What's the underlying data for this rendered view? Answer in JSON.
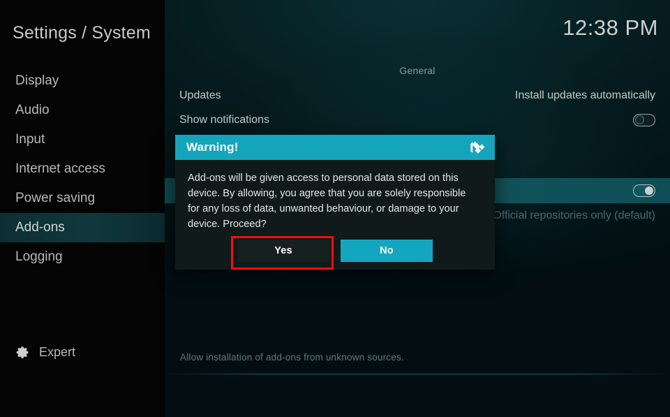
{
  "window": {
    "title": "Settings / System",
    "clock": "12:38 PM"
  },
  "sidebar": {
    "items": [
      {
        "label": "Display",
        "selected": false
      },
      {
        "label": "Audio",
        "selected": false
      },
      {
        "label": "Input",
        "selected": false
      },
      {
        "label": "Internet access",
        "selected": false
      },
      {
        "label": "Power saving",
        "selected": false
      },
      {
        "label": "Add-ons",
        "selected": true
      },
      {
        "label": "Logging",
        "selected": false
      }
    ],
    "level_button": {
      "label": "Expert",
      "icon": "gear-icon"
    }
  },
  "main": {
    "group_header": "General",
    "rows": [
      {
        "label": "Updates",
        "value": "Install updates automatically",
        "control": "text"
      },
      {
        "label": "Show notifications",
        "value": "",
        "control": "toggle",
        "state": "off"
      },
      {
        "label": "",
        "value": "",
        "control": "toggle",
        "state": "on"
      },
      {
        "label": "",
        "value": "Official repositories only (default)",
        "control": "text"
      }
    ],
    "hint": "Allow installation of add-ons from unknown sources."
  },
  "dialog": {
    "title": "Warning!",
    "logo_icon": "kodi-logo-icon",
    "message": "Add-ons will be given access to personal data stored on this device. By allowing, you agree that you are solely responsible for any loss of data, unwanted behaviour, or damage to your device. Proceed?",
    "buttons": {
      "yes": "Yes",
      "no": "No"
    }
  },
  "annotation": {
    "highlight_target": "yes-button",
    "color": "#f60e0e"
  },
  "colors": {
    "accent_teal": "#14a5bd",
    "dialog_body": "#101a1a",
    "sidebar_bg": "#040404",
    "row_highlight": "#12565d",
    "annotation_red": "#f60e0e"
  }
}
